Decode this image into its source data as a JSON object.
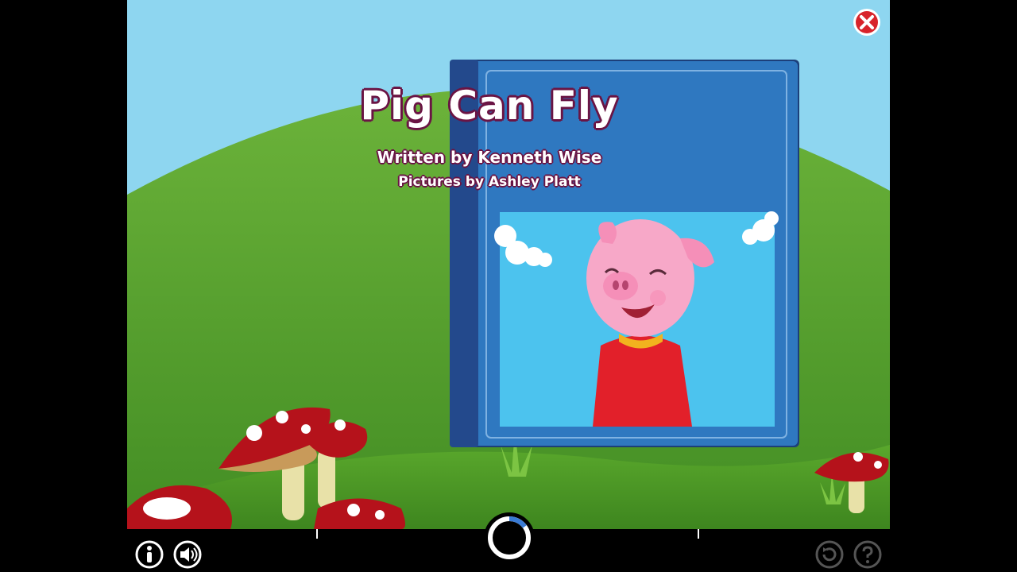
{
  "book": {
    "title": "Pig Can Fly",
    "written_by": "Written by Kenneth Wise",
    "pictures_by": "Pictures by Ashley Platt"
  },
  "icons": {
    "close": "close-icon",
    "info": "info-icon",
    "sound": "speaker-icon",
    "play": "play-progress-ring",
    "replay": "replay-icon",
    "help": "help-icon"
  },
  "playback": {
    "progress_fraction": 0.15
  },
  "colors": {
    "sky": "#8ed6f0",
    "grass": "#4f9a2a",
    "book_blue": "#2f6fb5",
    "title_outline": "#6a1444",
    "close_red": "#d8232a"
  }
}
